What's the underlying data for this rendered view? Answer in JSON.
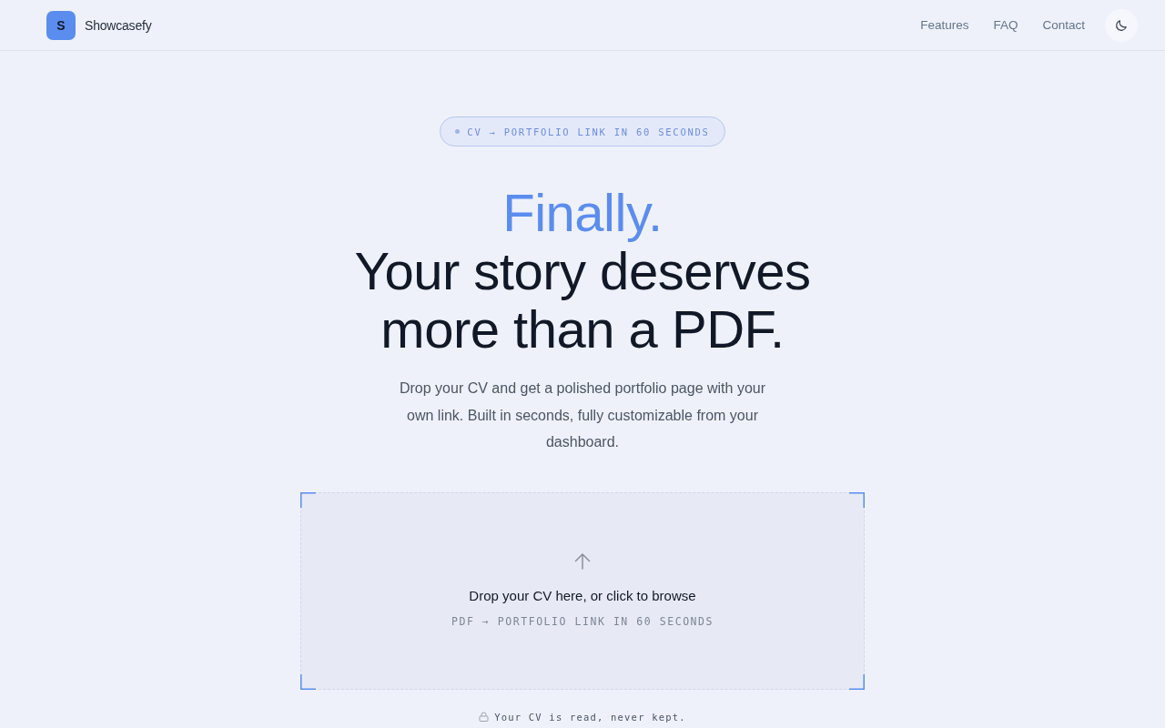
{
  "header": {
    "logo": {
      "letter": "S"
    },
    "brand": "Showcasefy",
    "nav": [
      {
        "label": "Features"
      },
      {
        "label": "FAQ"
      },
      {
        "label": "Contact"
      }
    ]
  },
  "hero": {
    "badge": "CV → PORTFOLIO LINK IN 60 SECONDS",
    "headline_accent": "Finally.",
    "headline": "Your story deserves more than a PDF.",
    "description": "Drop your CV and get a polished portfolio page with your own link. Built in seconds, fully customizable from your dashboard."
  },
  "dropzone": {
    "prompt": "Drop your CV here, or click to browse",
    "hint": "PDF → PORTFOLIO LINK IN 60 SECONDS"
  },
  "privacy_note": "Your CV is read, never kept."
}
